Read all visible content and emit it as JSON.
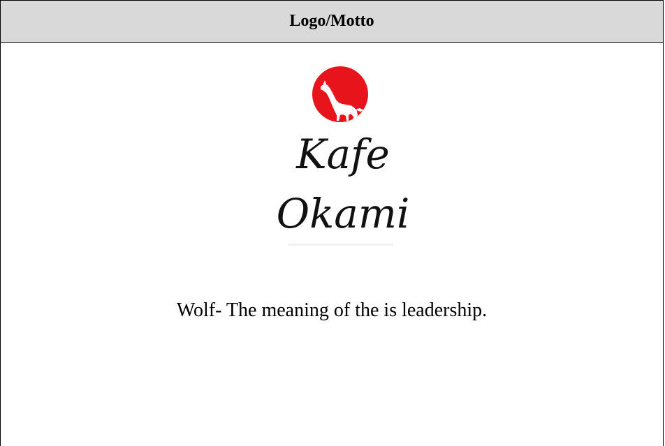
{
  "header": {
    "title": "Logo/Motto"
  },
  "logo": {
    "icon": "howling-wolf-icon",
    "sun_color": "#e8141b",
    "wordmark_line1": "Kafe",
    "wordmark_line2": "Okami"
  },
  "motto": {
    "text": "Wolf- The meaning of the is leadership."
  }
}
